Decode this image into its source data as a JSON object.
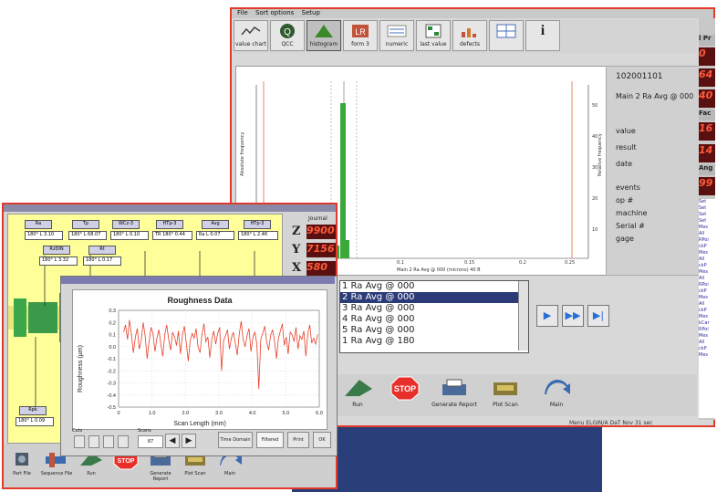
{
  "back_window": {
    "menu": [
      "File",
      "Sort options",
      "Setup"
    ],
    "toolbar": [
      {
        "label": "value chart",
        "icon": "value-chart-icon",
        "selected": false
      },
      {
        "label": "QCC",
        "icon": "qcc-icon",
        "selected": false
      },
      {
        "label": "histogram",
        "icon": "histogram-icon",
        "selected": true
      },
      {
        "label": "form 3",
        "icon": "form-icon",
        "selected": false
      },
      {
        "label": "numeric",
        "icon": "numeric-icon",
        "selected": false
      },
      {
        "label": "last value",
        "icon": "last-value-icon",
        "selected": false
      },
      {
        "label": "defects",
        "icon": "defects-icon",
        "selected": false
      },
      {
        "label": "",
        "icon": "table-icon",
        "selected": false
      },
      {
        "label": "i",
        "icon": "info-icon",
        "selected": false
      }
    ],
    "info": {
      "id": "102001101",
      "name": "Main 2 Ra Avg @ 000",
      "fields": [
        "value",
        "result",
        "date",
        "events",
        "op #",
        "machine",
        "Serial #",
        "gage"
      ]
    },
    "side_values": [
      "0",
      "0",
      "64",
      "40",
      "16",
      "14",
      "99"
    ],
    "side_labels": [
      "l Pr",
      "Fac",
      "Ang"
    ],
    "list_items": [
      "1 Ra Avg @ 000",
      "2 Ra Avg @ 000",
      "3 Ra Avg @ 000",
      "4 Ra Avg @ 000",
      "5 Ra Avg @ 000",
      "1 Ra Avg @ 180"
    ],
    "selected_index": 1,
    "bottom_buttons": [
      "Run",
      "",
      "Generate Report",
      "Plot Scan",
      "Main"
    ],
    "status": "Menu   ELGIN/A DaT   Nov 31 sec",
    "accent": "#e23a2a",
    "list_select": "#2b3b78"
  },
  "histogram": {
    "xlabel": "Main 2 Ra Avg @ 000 (microns) 40 B",
    "ylabel_left": "Absolute frequency",
    "ylabel_right": "Relative frequency",
    "xticks": [
      "0.1",
      "0.15",
      "0.2",
      "0.25"
    ],
    "yticks_right": [
      "50",
      "40",
      "30",
      "20",
      "10"
    ]
  },
  "front_window": {
    "params": [
      {
        "label": "Ra",
        "value": "180° L 3.10"
      },
      {
        "label": "Tp",
        "value": "180° L 68.07"
      },
      {
        "label": "WCz-3",
        "value": "180° L 0.10"
      },
      {
        "label": "HTp-3",
        "value": "TR 180° 0.44"
      },
      {
        "label": "Avg",
        "value": "Ra L 0.07"
      },
      {
        "label": "HTp-3",
        "value": "180° L 2.46"
      },
      {
        "label": "RzDIN",
        "value": "180° L 3.32"
      },
      {
        "label": "Rt",
        "value": "180° L 0.17"
      },
      {
        "label": "Rpk",
        "value": "180° L 0.09"
      }
    ],
    "side_title": "Journal",
    "axes": [
      {
        "letter": "Z",
        "value": "9900"
      },
      {
        "letter": "Y",
        "value": "7156"
      },
      {
        "letter": "X",
        "value": "580"
      }
    ],
    "bottom_buttons": [
      "Part File",
      "Sequence File",
      "Run",
      "STOP",
      "Generate Report",
      "Plot Scan",
      "Main"
    ]
  },
  "roughness": {
    "controls": {
      "cutoff_label": "Cuts",
      "scans_label": "Scans",
      "scans_value": "87",
      "buttons": [
        "Time Domain",
        "Filtered",
        "Print",
        "OK"
      ]
    }
  },
  "chart_data": {
    "type": "line",
    "title": "Roughness Data",
    "xlabel": "Scan Length (mm)",
    "ylabel": "Roughness (µm)",
    "xlim": [
      0,
      6.0
    ],
    "ylim": [
      -0.5,
      0.3
    ],
    "xticks": [
      "0",
      "1.0",
      "2.0",
      "3.0",
      "4.0",
      "5.0",
      "6.0"
    ],
    "yticks": [
      "0.3",
      "0.2",
      "0.1",
      "0.0",
      "-0.1",
      "-0.2",
      "-0.3",
      "-0.4",
      "-0.5"
    ],
    "series": [
      {
        "color": "#e8402a",
        "values": [
          0.12,
          0.18,
          0.06,
          0.22,
          0.1,
          -0.05,
          0.08,
          0.15,
          -0.02,
          0.05,
          0.2,
          0.09,
          -0.1,
          0.04,
          0.16,
          0.11,
          -0.04,
          0.07,
          0.14,
          0.02,
          -0.08,
          0.1,
          0.18,
          0.06,
          -0.03,
          0.12,
          0.08,
          0.01,
          0.13,
          -0.06,
          0.09,
          0.17,
          0.03,
          -0.12,
          0.05,
          0.11,
          0.07,
          0.15,
          0.0,
          -0.05,
          0.1,
          0.19,
          0.04,
          0.08,
          -0.09,
          0.06,
          0.13,
          0.02,
          0.11,
          0.16,
          -0.2,
          0.05,
          0.09,
          0.14,
          -0.02,
          0.07,
          0.12,
          0.03,
          -0.07,
          0.1,
          0.21,
          0.06,
          0.0,
          0.09,
          0.15,
          -0.04,
          0.08,
          0.12,
          0.02,
          -0.35,
          0.06,
          0.11,
          0.17,
          0.04,
          -0.03,
          0.09,
          0.14,
          0.05,
          -0.1,
          0.07,
          0.13,
          0.19,
          0.01,
          0.08,
          -0.06,
          0.12,
          0.1,
          0.04,
          0.16,
          -0.02,
          0.09,
          0.06,
          0.13,
          -0.08,
          0.11,
          0.18,
          0.03,
          0.07,
          0.02,
          0.1
        ]
      }
    ]
  }
}
